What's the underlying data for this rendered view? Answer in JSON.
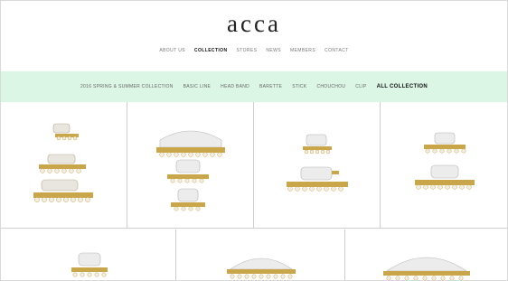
{
  "brand": {
    "logo": "acca"
  },
  "topnav": [
    {
      "label": "ABOUT US",
      "active": false
    },
    {
      "label": "COLLECTION",
      "active": true
    },
    {
      "label": "STORES",
      "active": false
    },
    {
      "label": "NEWS",
      "active": false
    },
    {
      "label": "MEMBERS",
      "active": false
    },
    {
      "label": "CONTACT",
      "active": false
    }
  ],
  "categories": [
    {
      "label": "2016 SPRING & SUMMER COLLECTION",
      "active": false
    },
    {
      "label": "BASIC LINE",
      "active": false
    },
    {
      "label": "HEAD BAND",
      "active": false
    },
    {
      "label": "BARETTE",
      "active": false
    },
    {
      "label": "STICK",
      "active": false
    },
    {
      "label": "CHOUCHOU",
      "active": false
    },
    {
      "label": "CLIP",
      "active": false
    },
    {
      "label": "ALL COLLECTION",
      "active": true
    }
  ],
  "colors": {
    "mint_bar": "#dcf6e6",
    "pearl": "#e9e6df",
    "gold": "#c9a64a",
    "clip_white": "#ececec"
  }
}
